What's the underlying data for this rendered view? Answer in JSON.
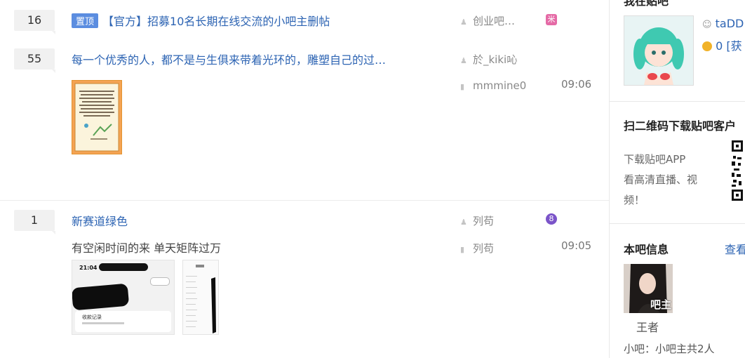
{
  "threads": [
    {
      "reply_count": "16",
      "badge": "置顶",
      "title": "【官方】招募10名长期在线交流的小吧主删帖",
      "author": "创业吧…",
      "level_badge": "米"
    },
    {
      "reply_count": "55",
      "title": "每一个优秀的人，都不是与生俱来带着光环的，雕塑自己的过…",
      "author": "於_kiki吣",
      "last_reply_user": "mmmine0",
      "last_reply_time": "09:06"
    },
    {
      "reply_count": "1",
      "title": "新赛道绿色",
      "abstract": "有空闲时间的来 单天矩阵过万",
      "author": "列苟",
      "level_badge": "8",
      "last_reply_user": "列苟",
      "last_reply_time": "09:05",
      "thumb_phone": {
        "time": "21:04",
        "record_label": "收款记录"
      }
    }
  ],
  "sidebar": {
    "my_forum_title": "我在贴吧",
    "username": "taDD",
    "coins": "0",
    "get_link": "[获",
    "qr_title": "扫二维码下载贴吧客户",
    "qr_desc_1": "下载贴吧APP",
    "qr_desc_2": "看高清直播、视",
    "qr_desc_3": "频！",
    "forum_info_title": "本吧信息",
    "view_link": "查看",
    "manager_badge": "吧主",
    "manager_name": "王者",
    "sub_managers": "小吧：小吧主共2人"
  }
}
